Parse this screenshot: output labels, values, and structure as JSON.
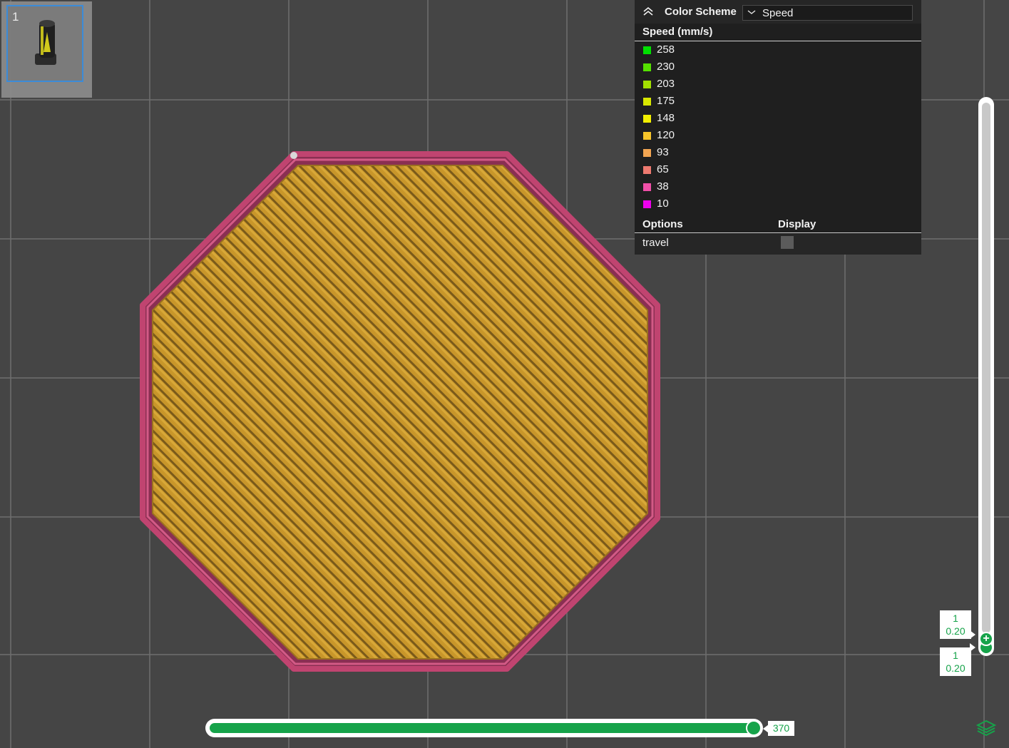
{
  "colors": {
    "background": "#454545",
    "grid": "#6e6e6e",
    "perimeter": "#c04470",
    "infill": "#c8962a",
    "slider_accent": "#16a34a",
    "thumbnail_border": "#3b8fe0"
  },
  "plate": {
    "thumbnail_number": "1",
    "model_icon": "nozzle-model-thumbnail"
  },
  "legend": {
    "color_scheme_label": "Color Scheme",
    "color_scheme_value": "Speed",
    "speed_title": "Speed (mm/s)",
    "items": [
      {
        "value": "258",
        "color": "#00e000"
      },
      {
        "value": "230",
        "color": "#55e000"
      },
      {
        "value": "203",
        "color": "#a2e000"
      },
      {
        "value": "175",
        "color": "#d8e800"
      },
      {
        "value": "148",
        "color": "#f2ee00"
      },
      {
        "value": "120",
        "color": "#f7c52a"
      },
      {
        "value": "93",
        "color": "#f2a552"
      },
      {
        "value": "65",
        "color": "#ee7a70"
      },
      {
        "value": "38",
        "color": "#f050a8"
      },
      {
        "value": "10",
        "color": "#ee00ee"
      }
    ],
    "options_label": "Options",
    "display_label": "Display",
    "options": [
      {
        "label": "travel",
        "checked": false
      }
    ]
  },
  "layer_slider": {
    "upper_layer": "1",
    "upper_height": "0.20",
    "lower_layer": "1",
    "lower_height": "0.20"
  },
  "move_slider": {
    "value": "370",
    "fraction": 1.0
  }
}
